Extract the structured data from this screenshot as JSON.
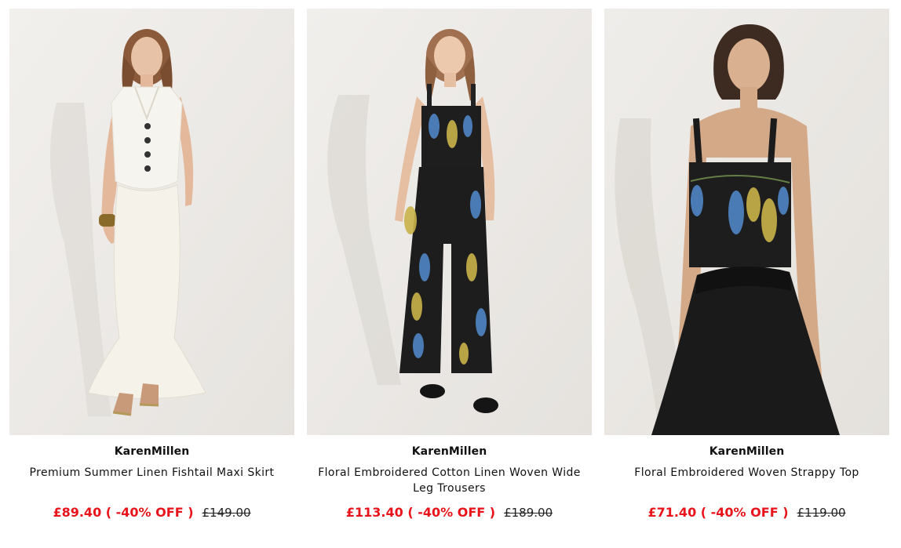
{
  "products": [
    {
      "brand": "KarenMillen",
      "name": "Premium Summer Linen Fishtail Maxi Skirt",
      "sale_price": "£89.40 ( -40% OFF )",
      "original_price": "£149.00"
    },
    {
      "brand": "KarenMillen",
      "name": "Floral Embroidered Cotton Linen Woven Wide Leg Trousers",
      "sale_price": "£113.40 ( -40% OFF )",
      "original_price": "£189.00"
    },
    {
      "brand": "KarenMillen",
      "name": "Floral Embroidered Woven Strappy Top",
      "sale_price": "£71.40 ( -40% OFF )",
      "original_price": "£119.00"
    }
  ],
  "colors": {
    "sale_red": "#e8131b",
    "text": "#111111",
    "photo_background": "#eeece9"
  }
}
